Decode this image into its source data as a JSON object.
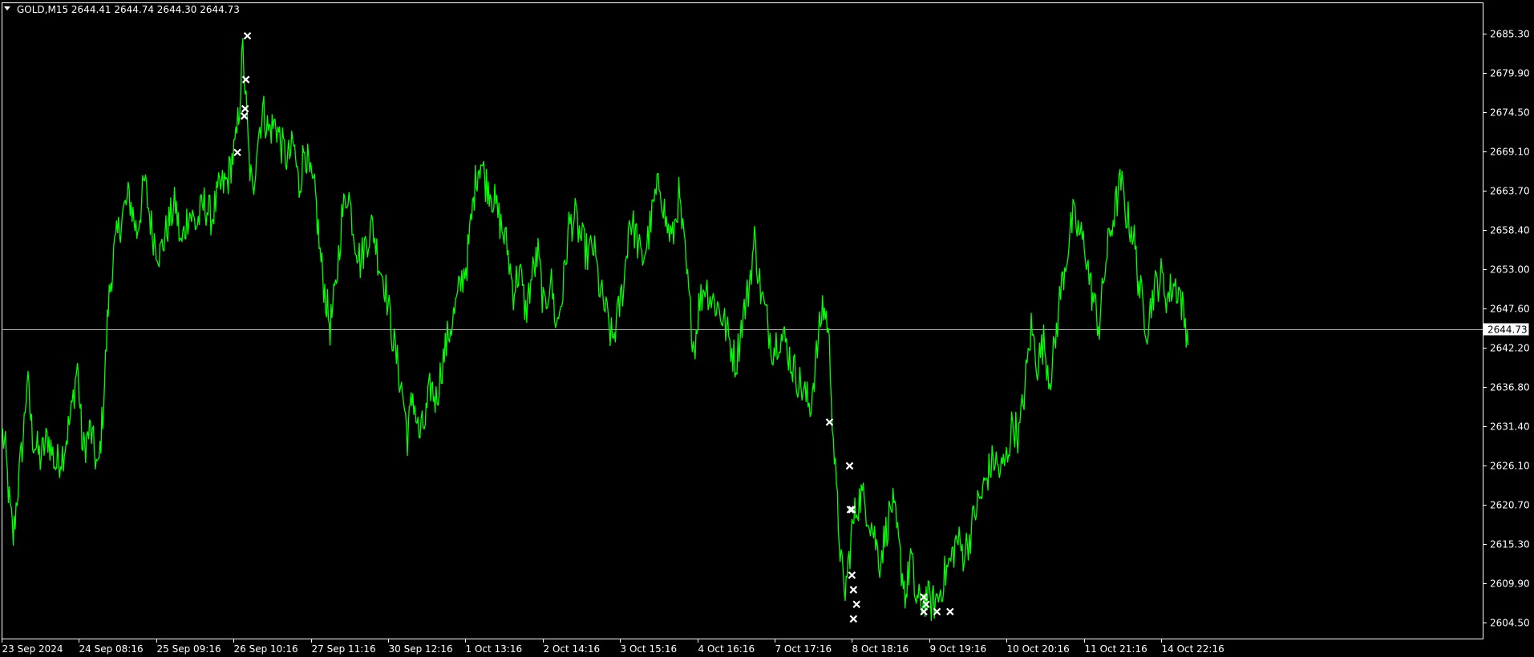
{
  "window": {
    "header": "GOLD,M15  2644.41 2644.74 2644.30 2644.73",
    "dropdown_icon": "triangle-down-icon"
  },
  "colors": {
    "background": "#000000",
    "price_line": "#00ff00",
    "axis": "#ffffff",
    "markers": "#ffffff",
    "current_price_line": "#b4b4b4"
  },
  "chart_data": {
    "type": "line",
    "symbol": "GOLD",
    "timeframe": "M15",
    "ohlc": {
      "open": 2644.41,
      "high": 2644.74,
      "low": 2644.3,
      "close": 2644.73
    },
    "current_price": 2644.73,
    "current_price_label": "2644.73",
    "ylim": [
      2602.5,
      2688.5
    ],
    "y_ticks": [
      {
        "value": 2685.3,
        "label": "2685.30"
      },
      {
        "value": 2679.9,
        "label": "2679.90"
      },
      {
        "value": 2674.5,
        "label": "2674.50"
      },
      {
        "value": 2669.1,
        "label": "2669.10"
      },
      {
        "value": 2663.7,
        "label": "2663.70"
      },
      {
        "value": 2658.4,
        "label": "2658.40"
      },
      {
        "value": 2653.0,
        "label": "2653.00"
      },
      {
        "value": 2647.6,
        "label": "2647.60"
      },
      {
        "value": 2642.2,
        "label": "2642.20"
      },
      {
        "value": 2636.8,
        "label": "2636.80"
      },
      {
        "value": 2631.4,
        "label": "2631.40"
      },
      {
        "value": 2626.1,
        "label": "2626.10"
      },
      {
        "value": 2620.7,
        "label": "2620.70"
      },
      {
        "value": 2615.3,
        "label": "2615.30"
      },
      {
        "value": 2609.9,
        "label": "2609.90"
      },
      {
        "value": 2604.5,
        "label": "2604.50"
      }
    ],
    "x_ticks": [
      {
        "index": 0,
        "label": "23 Sep 2024"
      },
      {
        "index": 1,
        "label": "24 Sep 08:16"
      },
      {
        "index": 2,
        "label": "25 Sep 09:16"
      },
      {
        "index": 3,
        "label": "26 Sep 10:16"
      },
      {
        "index": 4,
        "label": "27 Sep 11:16"
      },
      {
        "index": 5,
        "label": "30 Sep 12:16"
      },
      {
        "index": 6,
        "label": "1 Oct 13:16"
      },
      {
        "index": 7,
        "label": "2 Oct 14:16"
      },
      {
        "index": 8,
        "label": "3 Oct 15:16"
      },
      {
        "index": 9,
        "label": "4 Oct 16:16"
      },
      {
        "index": 10,
        "label": "7 Oct 17:16"
      },
      {
        "index": 11,
        "label": "8 Oct 18:16"
      },
      {
        "index": 12,
        "label": "9 Oct 19:16"
      },
      {
        "index": 13,
        "label": "10 Oct 20:16"
      },
      {
        "index": 14,
        "label": "11 Oct 21:16"
      },
      {
        "index": 15,
        "label": "14 Oct 22:16"
      }
    ],
    "x_range": [
      0,
      15.4
    ],
    "data_end": 15.35,
    "series": [
      {
        "values": [
          [
            0.0,
            2631
          ],
          [
            0.05,
            2628
          ],
          [
            0.1,
            2621
          ],
          [
            0.15,
            2616
          ],
          [
            0.2,
            2622
          ],
          [
            0.28,
            2630
          ],
          [
            0.33,
            2638
          ],
          [
            0.4,
            2630
          ],
          [
            0.5,
            2627
          ],
          [
            0.6,
            2630
          ],
          [
            0.7,
            2626
          ],
          [
            0.8,
            2628
          ],
          [
            0.9,
            2633
          ],
          [
            0.98,
            2640
          ],
          [
            1.05,
            2628
          ],
          [
            1.15,
            2631
          ],
          [
            1.25,
            2625
          ],
          [
            1.32,
            2635
          ],
          [
            1.38,
            2648
          ],
          [
            1.45,
            2655
          ],
          [
            1.55,
            2660
          ],
          [
            1.65,
            2663
          ],
          [
            1.75,
            2658
          ],
          [
            1.85,
            2665
          ],
          [
            1.95,
            2658
          ],
          [
            2.05,
            2655
          ],
          [
            2.15,
            2659
          ],
          [
            2.25,
            2662
          ],
          [
            2.32,
            2656
          ],
          [
            2.42,
            2661
          ],
          [
            2.52,
            2659
          ],
          [
            2.62,
            2662
          ],
          [
            2.72,
            2660
          ],
          [
            2.82,
            2664
          ],
          [
            2.92,
            2665
          ],
          [
            2.98,
            2668
          ],
          [
            3.03,
            2670
          ],
          [
            3.08,
            2676
          ],
          [
            3.12,
            2683
          ],
          [
            3.15,
            2678
          ],
          [
            3.2,
            2668
          ],
          [
            3.25,
            2663
          ],
          [
            3.3,
            2670
          ],
          [
            3.38,
            2675
          ],
          [
            3.45,
            2672
          ],
          [
            3.55,
            2673
          ],
          [
            3.62,
            2670
          ],
          [
            3.7,
            2668
          ],
          [
            3.78,
            2670
          ],
          [
            3.85,
            2664
          ],
          [
            3.92,
            2670
          ],
          [
            4.0,
            2665
          ],
          [
            4.06,
            2663
          ],
          [
            4.12,
            2655
          ],
          [
            4.18,
            2650
          ],
          [
            4.25,
            2645
          ],
          [
            4.32,
            2650
          ],
          [
            4.4,
            2660
          ],
          [
            4.48,
            2664
          ],
          [
            4.56,
            2658
          ],
          [
            4.64,
            2654
          ],
          [
            4.72,
            2657
          ],
          [
            4.8,
            2659
          ],
          [
            4.88,
            2654
          ],
          [
            4.96,
            2651
          ],
          [
            5.04,
            2645
          ],
          [
            5.12,
            2640
          ],
          [
            5.2,
            2635
          ],
          [
            5.25,
            2630
          ],
          [
            5.32,
            2636
          ],
          [
            5.4,
            2630
          ],
          [
            5.48,
            2632
          ],
          [
            5.55,
            2637
          ],
          [
            5.62,
            2635
          ],
          [
            5.7,
            2640
          ],
          [
            5.78,
            2644
          ],
          [
            5.86,
            2647
          ],
          [
            5.94,
            2651
          ],
          [
            6.02,
            2654
          ],
          [
            6.08,
            2660
          ],
          [
            6.14,
            2666
          ],
          [
            6.2,
            2668
          ],
          [
            6.26,
            2665
          ],
          [
            6.32,
            2664
          ],
          [
            6.38,
            2662
          ],
          [
            6.46,
            2659
          ],
          [
            6.54,
            2656
          ],
          [
            6.62,
            2650
          ],
          [
            6.7,
            2653
          ],
          [
            6.78,
            2647
          ],
          [
            6.86,
            2652
          ],
          [
            6.94,
            2655
          ],
          [
            7.02,
            2647
          ],
          [
            7.1,
            2652
          ],
          [
            7.18,
            2645
          ],
          [
            7.26,
            2650
          ],
          [
            7.34,
            2659
          ],
          [
            7.42,
            2660
          ],
          [
            7.5,
            2657
          ],
          [
            7.58,
            2655
          ],
          [
            7.66,
            2656
          ],
          [
            7.74,
            2650
          ],
          [
            7.82,
            2647
          ],
          [
            7.9,
            2643
          ],
          [
            7.98,
            2647
          ],
          [
            8.06,
            2652
          ],
          [
            8.12,
            2660
          ],
          [
            8.2,
            2658
          ],
          [
            8.28,
            2654
          ],
          [
            8.36,
            2657
          ],
          [
            8.44,
            2662
          ],
          [
            8.52,
            2665
          ],
          [
            8.6,
            2659
          ],
          [
            8.68,
            2657
          ],
          [
            8.76,
            2663
          ],
          [
            8.84,
            2655
          ],
          [
            8.9,
            2648
          ],
          [
            8.96,
            2642
          ],
          [
            9.02,
            2648
          ],
          [
            9.1,
            2651
          ],
          [
            9.18,
            2649
          ],
          [
            9.26,
            2648
          ],
          [
            9.34,
            2646
          ],
          [
            9.42,
            2643
          ],
          [
            9.5,
            2640
          ],
          [
            9.58,
            2646
          ],
          [
            9.66,
            2650
          ],
          [
            9.74,
            2657
          ],
          [
            9.82,
            2650
          ],
          [
            9.9,
            2646
          ],
          [
            9.98,
            2642
          ],
          [
            10.06,
            2644
          ],
          [
            10.14,
            2643
          ],
          [
            10.22,
            2640
          ],
          [
            10.3,
            2638
          ],
          [
            10.38,
            2636
          ],
          [
            10.46,
            2634
          ],
          [
            10.54,
            2641
          ],
          [
            10.62,
            2648
          ],
          [
            10.68,
            2646
          ],
          [
            10.72,
            2640
          ],
          [
            10.76,
            2630
          ],
          [
            10.8,
            2622
          ],
          [
            10.86,
            2613
          ],
          [
            10.9,
            2608
          ],
          [
            10.95,
            2612
          ],
          [
            11.0,
            2617
          ],
          [
            11.05,
            2620
          ],
          [
            11.12,
            2622
          ],
          [
            11.2,
            2620
          ],
          [
            11.28,
            2617
          ],
          [
            11.36,
            2613
          ],
          [
            11.44,
            2617
          ],
          [
            11.52,
            2621
          ],
          [
            11.58,
            2617
          ],
          [
            11.64,
            2612
          ],
          [
            11.7,
            2608
          ],
          [
            11.76,
            2614
          ],
          [
            11.82,
            2608
          ],
          [
            11.88,
            2607
          ],
          [
            11.96,
            2608
          ],
          [
            12.04,
            2607
          ],
          [
            12.12,
            2608
          ],
          [
            12.2,
            2611
          ],
          [
            12.28,
            2613
          ],
          [
            12.36,
            2616
          ],
          [
            12.44,
            2614
          ],
          [
            12.52,
            2616
          ],
          [
            12.6,
            2620
          ],
          [
            12.68,
            2622
          ],
          [
            12.76,
            2625
          ],
          [
            12.84,
            2627
          ],
          [
            12.92,
            2625
          ],
          [
            13.0,
            2627
          ],
          [
            13.08,
            2632
          ],
          [
            13.16,
            2630
          ],
          [
            13.24,
            2637
          ],
          [
            13.32,
            2645
          ],
          [
            13.4,
            2640
          ],
          [
            13.48,
            2643
          ],
          [
            13.56,
            2638
          ],
          [
            13.62,
            2642
          ],
          [
            13.7,
            2650
          ],
          [
            13.78,
            2655
          ],
          [
            13.86,
            2660
          ],
          [
            13.94,
            2658
          ],
          [
            14.02,
            2656
          ],
          [
            14.08,
            2651
          ],
          [
            14.14,
            2648
          ],
          [
            14.2,
            2645
          ],
          [
            14.26,
            2652
          ],
          [
            14.34,
            2658
          ],
          [
            14.42,
            2662
          ],
          [
            14.48,
            2665
          ],
          [
            14.56,
            2660
          ],
          [
            14.64,
            2658
          ],
          [
            14.7,
            2652
          ],
          [
            14.76,
            2648
          ],
          [
            14.82,
            2645
          ],
          [
            14.9,
            2650
          ],
          [
            15.0,
            2652
          ],
          [
            15.08,
            2649
          ],
          [
            15.16,
            2651
          ],
          [
            15.24,
            2650
          ],
          [
            15.3,
            2646
          ],
          [
            15.35,
            2644
          ]
        ]
      }
    ],
    "markers": [
      {
        "x": 3.05,
        "y": 2669
      },
      {
        "x": 3.14,
        "y": 2674
      },
      {
        "x": 3.15,
        "y": 2675
      },
      {
        "x": 3.16,
        "y": 2679
      },
      {
        "x": 3.18,
        "y": 2685
      },
      {
        "x": 10.71,
        "y": 2632
      },
      {
        "x": 10.97,
        "y": 2626
      },
      {
        "x": 10.98,
        "y": 2620
      },
      {
        "x": 11.0,
        "y": 2620
      },
      {
        "x": 11.0,
        "y": 2611
      },
      {
        "x": 11.02,
        "y": 2609
      },
      {
        "x": 11.06,
        "y": 2607
      },
      {
        "x": 11.02,
        "y": 2605
      },
      {
        "x": 11.93,
        "y": 2608
      },
      {
        "x": 11.96,
        "y": 2607
      },
      {
        "x": 11.93,
        "y": 2606
      },
      {
        "x": 12.1,
        "y": 2606
      },
      {
        "x": 12.27,
        "y": 2606
      }
    ]
  }
}
